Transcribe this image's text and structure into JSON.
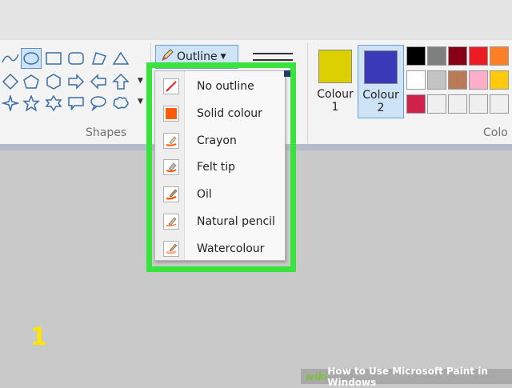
{
  "ribbon": {
    "shapes_group_label": "Shapes",
    "colours_group_label": "Colo",
    "outline_button_label": "Outline",
    "colour1": {
      "line1": "Colour",
      "line2": "1",
      "color": "#ddd000"
    },
    "colour2": {
      "line1": "Colour",
      "line2": "2",
      "color": "#3a3ab8"
    },
    "palette_row1": [
      "#000000",
      "#7f7f7f",
      "#880015",
      "#ed1c24",
      "#ff7f27"
    ],
    "palette_row2": [
      "#ffffff",
      "#c3c3c3",
      "#b97a57",
      "#ffaec9",
      "#ffc90e"
    ],
    "palette_row3": [
      "#d0214b",
      "#f0f0f0",
      "#f0f0f0",
      "#f0f0f0",
      "#f0f0f0"
    ]
  },
  "outline_menu": {
    "items": [
      {
        "label": "No outline",
        "icon": "no-outline-icon"
      },
      {
        "label": "Solid colour",
        "icon": "solid-colour-icon"
      },
      {
        "label": "Crayon",
        "icon": "crayon-icon"
      },
      {
        "label": "Felt tip",
        "icon": "felt-tip-icon"
      },
      {
        "label": "Oil",
        "icon": "oil-icon"
      },
      {
        "label": "Natural pencil",
        "icon": "natural-pencil-icon"
      },
      {
        "label": "Watercolour",
        "icon": "watercolour-icon"
      }
    ]
  },
  "overlay": {
    "step_number": "1",
    "watermark_brand": "wiki",
    "watermark_text": "How to Use Microsoft Paint in Windows"
  },
  "colors": {
    "highlight": "#37e33c",
    "selected": "#cfe3f6",
    "accent_orange": "#ff5a0a"
  }
}
